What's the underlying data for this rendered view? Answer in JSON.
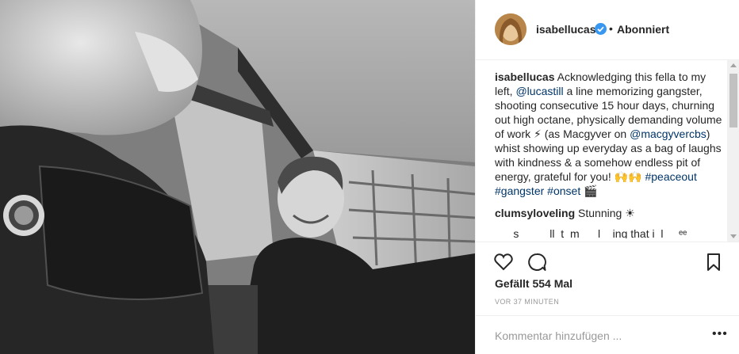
{
  "post": {
    "image_alt": "",
    "header": {
      "username": "isabellucas",
      "separator": "•",
      "follow_status": "Abonniert"
    },
    "caption": {
      "username": "isabellucas",
      "text_1": " Acknowledging this fella to my left, ",
      "mention_1": "@lucastill",
      "text_2": " a line memorizing gangster, shooting consecutive 15 hour days, churning out high octane, physically demanding volume of work ⚡ (as Macgyver on ",
      "mention_2": "@macgyvercbs",
      "text_3": ") whist showing up everyday as a bag of laughs with kindness & a somehow endless pit of energy, grateful for you! 🙌🙌 ",
      "hashtag_1": "#peaceout",
      "text_4": " ",
      "hashtag_2": "#gangster",
      "text_5": " ",
      "hashtag_3": "#onset",
      "text_6": " 🎬"
    },
    "comments": [
      {
        "username": "clumsyloveling",
        "text": " Stunning ☀"
      }
    ],
    "partial_comment": "___s_____ll_t_m___l__ing that i_l__ ᵉᵉ",
    "likes": "Gefällt 554 Mal",
    "timestamp": "VOR 37 MINUTEN",
    "comment_placeholder": "Kommentar hinzufügen ...",
    "more_label": "•••",
    "icons": {
      "like": "heart-icon",
      "comment": "comment-icon",
      "save": "bookmark-icon",
      "verified": "verified-badge-icon"
    },
    "colors": {
      "link": "#003569",
      "verified": "#3897f0",
      "text": "#262626",
      "muted": "#999999"
    }
  }
}
